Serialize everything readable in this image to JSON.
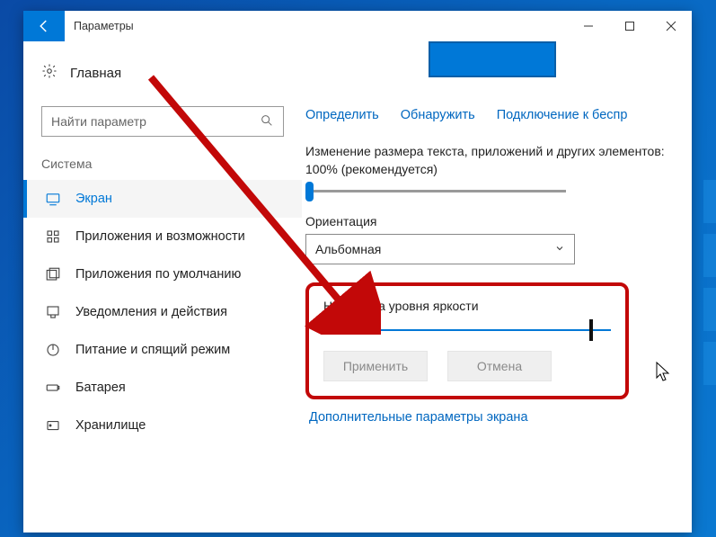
{
  "titlebar": {
    "title": "Параметры"
  },
  "sidebar": {
    "home": "Главная",
    "search_placeholder": "Найти параметр",
    "section": "Система",
    "items": [
      {
        "label": "Экран"
      },
      {
        "label": "Приложения и возможности"
      },
      {
        "label": "Приложения по умолчанию"
      },
      {
        "label": "Уведомления и действия"
      },
      {
        "label": "Питание и спящий режим"
      },
      {
        "label": "Батарея"
      },
      {
        "label": "Хранилище"
      }
    ]
  },
  "main": {
    "links": {
      "identify": "Определить",
      "detect": "Обнаружить",
      "wireless": "Подключение к беспр"
    },
    "scale_text": "Изменение размера текста, приложений и других элементов: 100% (рекомендуется)",
    "orientation_label": "Ориентация",
    "orientation_value": "Альбомная",
    "brightness_label": "Настройка уровня яркости",
    "apply": "Применить",
    "cancel": "Отмена",
    "advanced": "Дополнительные параметры экрана"
  }
}
